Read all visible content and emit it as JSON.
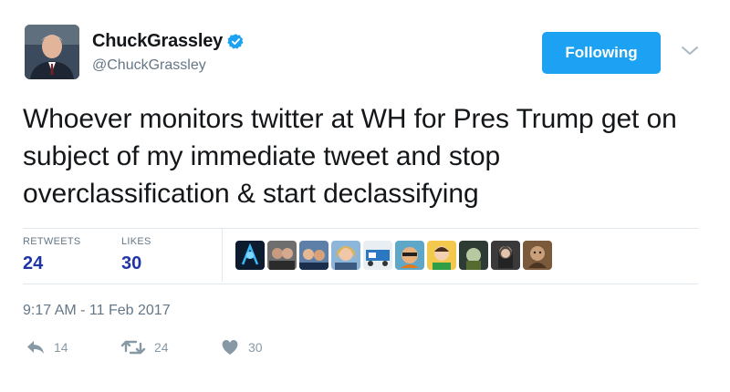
{
  "user": {
    "display_name": "ChuckGrassley",
    "handle": "@ChuckGrassley",
    "verified": true,
    "avatar_icon": "profile-photo-avatar"
  },
  "follow_button": {
    "label": "Following"
  },
  "menu_icon": "chevron-down-icon",
  "tweet": {
    "text": "Whoever monitors twitter at WH for Pres Trump get on subject of my immediate tweet and stop overclassification & start declassifying"
  },
  "stats": {
    "retweets_label": "RETWEETS",
    "retweets_count": "24",
    "likes_label": "LIKES",
    "likes_count": "30"
  },
  "likers": [
    "liker-avatar-1",
    "liker-avatar-2",
    "liker-avatar-3",
    "liker-avatar-4",
    "liker-avatar-5",
    "liker-avatar-6",
    "liker-avatar-7",
    "liker-avatar-8",
    "liker-avatar-9",
    "liker-avatar-10"
  ],
  "timestamp": "9:17 AM - 11 Feb 2017",
  "actions": {
    "reply": {
      "icon": "reply-icon",
      "count": "14"
    },
    "retweet": {
      "icon": "retweet-icon",
      "count": "24"
    },
    "like": {
      "icon": "heart-icon",
      "count": "30"
    }
  },
  "colors": {
    "accent": "#1da1f2",
    "stat_count": "#1f35a7",
    "secondary_text": "#657786",
    "action_gray": "#8899a6"
  }
}
